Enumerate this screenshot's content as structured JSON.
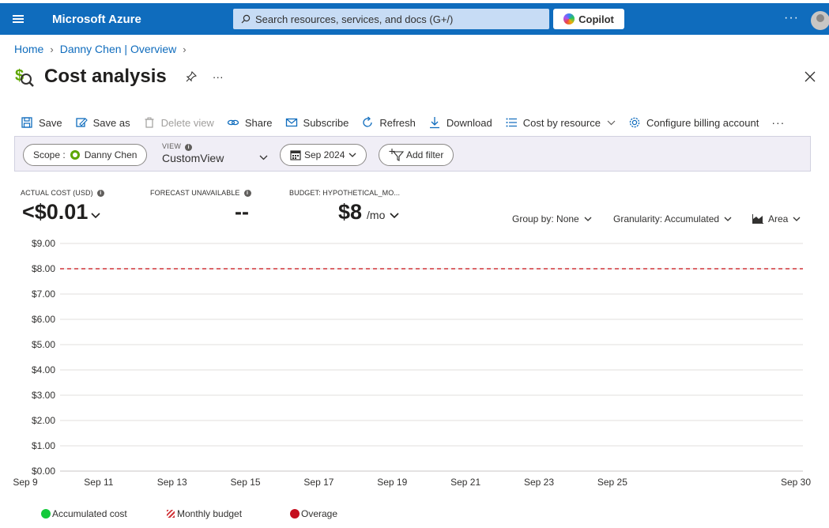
{
  "topbar": {
    "brand": "Microsoft Azure",
    "search_placeholder": "Search resources, services, and docs (G+/)",
    "copilot_label": "Copilot",
    "more": "···"
  },
  "breadcrumb": {
    "home": "Home",
    "parent": "Danny Chen | Overview"
  },
  "page": {
    "title": "Cost analysis",
    "more": "···"
  },
  "toolbar": {
    "save": "Save",
    "save_as": "Save as",
    "delete_view": "Delete view",
    "share": "Share",
    "subscribe": "Subscribe",
    "refresh": "Refresh",
    "download": "Download",
    "cost_by_resource": "Cost by resource",
    "configure_billing": "Configure billing account",
    "more": "···"
  },
  "filters": {
    "scope_label": "Scope :",
    "scope_value": "Danny Chen",
    "view_label": "VIEW",
    "view_value": "CustomView",
    "date_value": "Sep 2024",
    "add_filter": "Add filter"
  },
  "kpis": {
    "actual_label": "ACTUAL COST (USD)",
    "actual_value": "<$0.01",
    "forecast_label": "FORECAST UNAVAILABLE",
    "forecast_value": "--",
    "budget_label": "BUDGET: HYPOTHETICAL_MO...",
    "budget_value": "$8",
    "budget_suffix": "/mo"
  },
  "controls": {
    "group_by": "Group by: None",
    "granularity": "Granularity: Accumulated",
    "chart_type": "Area"
  },
  "chart_data": {
    "type": "area",
    "y_ticks": [
      "$9.00",
      "$8.00",
      "$7.00",
      "$6.00",
      "$5.00",
      "$4.00",
      "$3.00",
      "$2.00",
      "$1.00",
      "$0.00"
    ],
    "ylim": [
      0,
      9
    ],
    "x_ticks": [
      {
        "day": 9,
        "label": "Sep 9"
      },
      {
        "day": 11,
        "label": "Sep 11"
      },
      {
        "day": 13,
        "label": "Sep 13"
      },
      {
        "day": 15,
        "label": "Sep 15"
      },
      {
        "day": 17,
        "label": "Sep 17"
      },
      {
        "day": 19,
        "label": "Sep 19"
      },
      {
        "day": 21,
        "label": "Sep 21"
      },
      {
        "day": 23,
        "label": "Sep 23"
      },
      {
        "day": 25,
        "label": "Sep 25"
      },
      {
        "day": 30,
        "label": "Sep 30"
      }
    ],
    "xlim": [
      9,
      30
    ],
    "budget_line": 8,
    "budget_color": "#d13438",
    "grid": true
  },
  "legend": {
    "accumulated": "Accumulated cost",
    "accumulated_color": "#13c93a",
    "monthly_budget": "Monthly budget",
    "overage": "Overage",
    "overage_color": "#c50f1f"
  }
}
